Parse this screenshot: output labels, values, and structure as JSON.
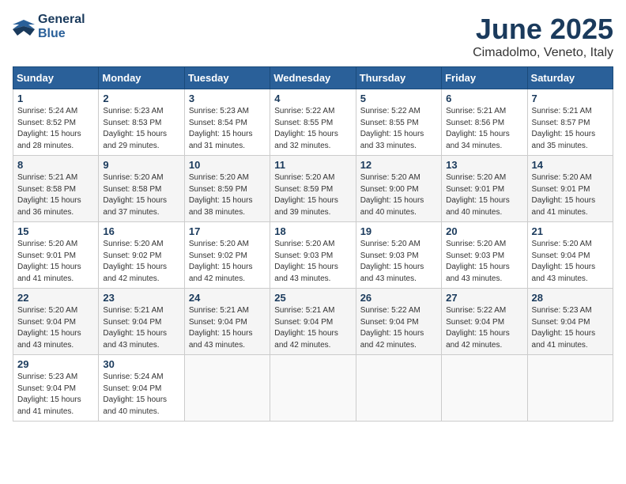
{
  "header": {
    "logo_line1": "General",
    "logo_line2": "Blue",
    "month_title": "June 2025",
    "location": "Cimadolmo, Veneto, Italy"
  },
  "weekdays": [
    "Sunday",
    "Monday",
    "Tuesday",
    "Wednesday",
    "Thursday",
    "Friday",
    "Saturday"
  ],
  "weeks": [
    [
      {
        "day": "1",
        "sunrise": "Sunrise: 5:24 AM",
        "sunset": "Sunset: 8:52 PM",
        "daylight": "Daylight: 15 hours and 28 minutes."
      },
      {
        "day": "2",
        "sunrise": "Sunrise: 5:23 AM",
        "sunset": "Sunset: 8:53 PM",
        "daylight": "Daylight: 15 hours and 29 minutes."
      },
      {
        "day": "3",
        "sunrise": "Sunrise: 5:23 AM",
        "sunset": "Sunset: 8:54 PM",
        "daylight": "Daylight: 15 hours and 31 minutes."
      },
      {
        "day": "4",
        "sunrise": "Sunrise: 5:22 AM",
        "sunset": "Sunset: 8:55 PM",
        "daylight": "Daylight: 15 hours and 32 minutes."
      },
      {
        "day": "5",
        "sunrise": "Sunrise: 5:22 AM",
        "sunset": "Sunset: 8:55 PM",
        "daylight": "Daylight: 15 hours and 33 minutes."
      },
      {
        "day": "6",
        "sunrise": "Sunrise: 5:21 AM",
        "sunset": "Sunset: 8:56 PM",
        "daylight": "Daylight: 15 hours and 34 minutes."
      },
      {
        "day": "7",
        "sunrise": "Sunrise: 5:21 AM",
        "sunset": "Sunset: 8:57 PM",
        "daylight": "Daylight: 15 hours and 35 minutes."
      }
    ],
    [
      {
        "day": "8",
        "sunrise": "Sunrise: 5:21 AM",
        "sunset": "Sunset: 8:58 PM",
        "daylight": "Daylight: 15 hours and 36 minutes."
      },
      {
        "day": "9",
        "sunrise": "Sunrise: 5:20 AM",
        "sunset": "Sunset: 8:58 PM",
        "daylight": "Daylight: 15 hours and 37 minutes."
      },
      {
        "day": "10",
        "sunrise": "Sunrise: 5:20 AM",
        "sunset": "Sunset: 8:59 PM",
        "daylight": "Daylight: 15 hours and 38 minutes."
      },
      {
        "day": "11",
        "sunrise": "Sunrise: 5:20 AM",
        "sunset": "Sunset: 8:59 PM",
        "daylight": "Daylight: 15 hours and 39 minutes."
      },
      {
        "day": "12",
        "sunrise": "Sunrise: 5:20 AM",
        "sunset": "Sunset: 9:00 PM",
        "daylight": "Daylight: 15 hours and 40 minutes."
      },
      {
        "day": "13",
        "sunrise": "Sunrise: 5:20 AM",
        "sunset": "Sunset: 9:01 PM",
        "daylight": "Daylight: 15 hours and 40 minutes."
      },
      {
        "day": "14",
        "sunrise": "Sunrise: 5:20 AM",
        "sunset": "Sunset: 9:01 PM",
        "daylight": "Daylight: 15 hours and 41 minutes."
      }
    ],
    [
      {
        "day": "15",
        "sunrise": "Sunrise: 5:20 AM",
        "sunset": "Sunset: 9:01 PM",
        "daylight": "Daylight: 15 hours and 41 minutes."
      },
      {
        "day": "16",
        "sunrise": "Sunrise: 5:20 AM",
        "sunset": "Sunset: 9:02 PM",
        "daylight": "Daylight: 15 hours and 42 minutes."
      },
      {
        "day": "17",
        "sunrise": "Sunrise: 5:20 AM",
        "sunset": "Sunset: 9:02 PM",
        "daylight": "Daylight: 15 hours and 42 minutes."
      },
      {
        "day": "18",
        "sunrise": "Sunrise: 5:20 AM",
        "sunset": "Sunset: 9:03 PM",
        "daylight": "Daylight: 15 hours and 43 minutes."
      },
      {
        "day": "19",
        "sunrise": "Sunrise: 5:20 AM",
        "sunset": "Sunset: 9:03 PM",
        "daylight": "Daylight: 15 hours and 43 minutes."
      },
      {
        "day": "20",
        "sunrise": "Sunrise: 5:20 AM",
        "sunset": "Sunset: 9:03 PM",
        "daylight": "Daylight: 15 hours and 43 minutes."
      },
      {
        "day": "21",
        "sunrise": "Sunrise: 5:20 AM",
        "sunset": "Sunset: 9:04 PM",
        "daylight": "Daylight: 15 hours and 43 minutes."
      }
    ],
    [
      {
        "day": "22",
        "sunrise": "Sunrise: 5:20 AM",
        "sunset": "Sunset: 9:04 PM",
        "daylight": "Daylight: 15 hours and 43 minutes."
      },
      {
        "day": "23",
        "sunrise": "Sunrise: 5:21 AM",
        "sunset": "Sunset: 9:04 PM",
        "daylight": "Daylight: 15 hours and 43 minutes."
      },
      {
        "day": "24",
        "sunrise": "Sunrise: 5:21 AM",
        "sunset": "Sunset: 9:04 PM",
        "daylight": "Daylight: 15 hours and 43 minutes."
      },
      {
        "day": "25",
        "sunrise": "Sunrise: 5:21 AM",
        "sunset": "Sunset: 9:04 PM",
        "daylight": "Daylight: 15 hours and 42 minutes."
      },
      {
        "day": "26",
        "sunrise": "Sunrise: 5:22 AM",
        "sunset": "Sunset: 9:04 PM",
        "daylight": "Daylight: 15 hours and 42 minutes."
      },
      {
        "day": "27",
        "sunrise": "Sunrise: 5:22 AM",
        "sunset": "Sunset: 9:04 PM",
        "daylight": "Daylight: 15 hours and 42 minutes."
      },
      {
        "day": "28",
        "sunrise": "Sunrise: 5:23 AM",
        "sunset": "Sunset: 9:04 PM",
        "daylight": "Daylight: 15 hours and 41 minutes."
      }
    ],
    [
      {
        "day": "29",
        "sunrise": "Sunrise: 5:23 AM",
        "sunset": "Sunset: 9:04 PM",
        "daylight": "Daylight: 15 hours and 41 minutes."
      },
      {
        "day": "30",
        "sunrise": "Sunrise: 5:24 AM",
        "sunset": "Sunset: 9:04 PM",
        "daylight": "Daylight: 15 hours and 40 minutes."
      },
      {
        "day": "",
        "sunrise": "",
        "sunset": "",
        "daylight": ""
      },
      {
        "day": "",
        "sunrise": "",
        "sunset": "",
        "daylight": ""
      },
      {
        "day": "",
        "sunrise": "",
        "sunset": "",
        "daylight": ""
      },
      {
        "day": "",
        "sunrise": "",
        "sunset": "",
        "daylight": ""
      },
      {
        "day": "",
        "sunrise": "",
        "sunset": "",
        "daylight": ""
      }
    ]
  ]
}
